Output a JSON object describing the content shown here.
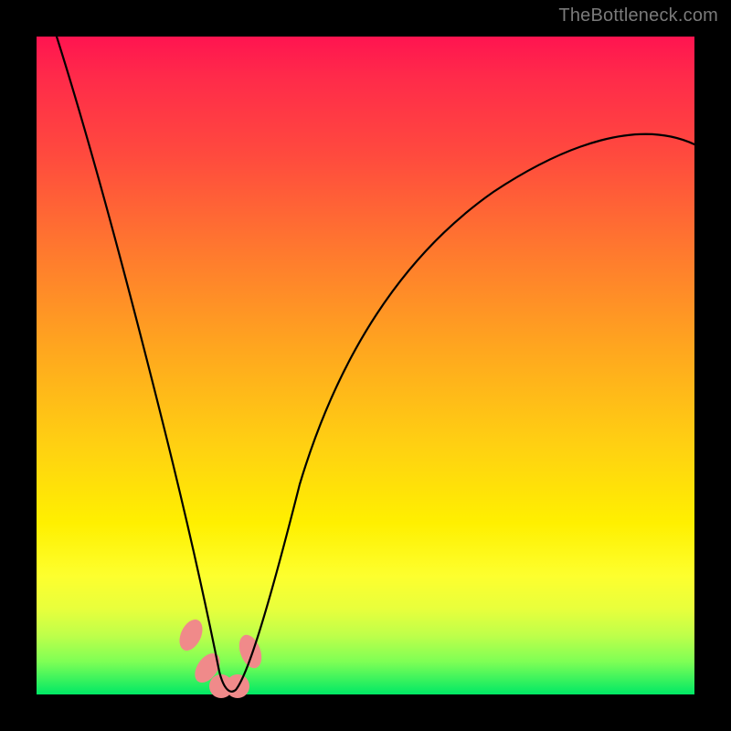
{
  "watermark": "TheBottleneck.com",
  "chart_data": {
    "type": "line",
    "title": "",
    "xlabel": "",
    "ylabel": "",
    "xlim": [
      0,
      100
    ],
    "ylim": [
      0,
      100
    ],
    "series": [
      {
        "name": "curve",
        "x": [
          3,
          8,
          13,
          18,
          21,
          24,
          26,
          27,
          28,
          29,
          30,
          31,
          33,
          36,
          40,
          46,
          53,
          60,
          70,
          80,
          90,
          100
        ],
        "y": [
          100,
          74,
          54,
          37,
          26,
          16,
          8,
          4,
          1,
          0,
          1,
          4,
          10,
          20,
          32,
          46,
          57,
          65,
          73,
          78,
          81,
          83
        ]
      }
    ],
    "markers": [
      {
        "x": 23.5,
        "y": 9
      },
      {
        "x": 26.0,
        "y": 4
      },
      {
        "x": 28.0,
        "y": 1
      },
      {
        "x": 30.5,
        "y": 1
      },
      {
        "x": 32.5,
        "y": 6.5
      }
    ],
    "background_gradient": {
      "top": "#ff1450",
      "mid_upper": "#ff7a2e",
      "mid": "#fff000",
      "lower": "#bfff4a",
      "bottom": "#00e865"
    }
  }
}
